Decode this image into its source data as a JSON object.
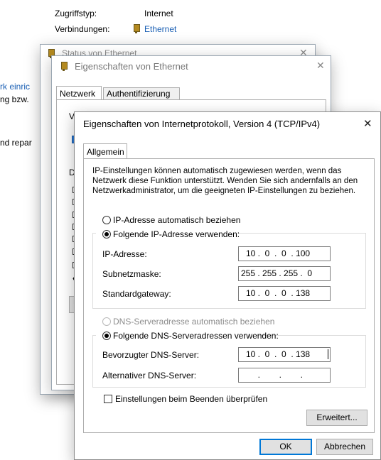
{
  "background": {
    "access_type_label": "Zugriffstyp:",
    "access_type_value": "Internet",
    "connections_label": "Verbindungen:",
    "connections_value": "Ethernet",
    "left_fragments": [
      "rk einric",
      "ng bzw.",
      "nd repar"
    ]
  },
  "status_window": {
    "title": "Status von Ethernet",
    "close_glyph": "✕"
  },
  "properties_window": {
    "title": "Eigenschaften von Ethernet",
    "close_glyph": "✕",
    "tabs": [
      "Netzwerk",
      "Authentifizierung"
    ],
    "fragment_top": "Verbindung herstellen über:",
    "fragment_list": "Die",
    "fragment_e": "B"
  },
  "ipv4_dialog": {
    "title": "Eigenschaften von Internetprotokoll, Version 4 (TCP/IPv4)",
    "close_glyph": "✕",
    "tab": "Allgemein",
    "description": [
      "IP-Einstellungen können automatisch zugewiesen werden, wenn das",
      "Netzwerk diese Funktion unterstützt. Wenden Sie sich andernfalls an den",
      "Netzwerkadministrator, um die geeigneten IP-Einstellungen zu beziehen."
    ],
    "ip_auto_label": "IP-Adresse automatisch beziehen",
    "ip_manual_label": "Folgende IP-Adresse verwenden:",
    "ip_address_label": "IP-Adresse:",
    "ip_address_value": "10 .  0  .  0  . 100",
    "subnet_label": "Subnetzmaske:",
    "subnet_value": "255 . 255 . 255 .  0",
    "gateway_label": "Standardgateway:",
    "gateway_value": "10 .  0  .  0  . 138",
    "dns_auto_label": "DNS-Serveradresse automatisch beziehen",
    "dns_manual_label": "Folgende DNS-Serveradressen verwenden:",
    "dns_preferred_label": "Bevorzugter DNS-Server:",
    "dns_preferred_value": "10 .  0  .  0  . 138",
    "dns_alternate_label": "Alternativer DNS-Server:",
    "dns_alternate_value": "     .        .        .",
    "validate_label": "Einstellungen beim Beenden überprüfen",
    "advanced_button": "Erweitert...",
    "ok_button": "OK",
    "cancel_button": "Abbrechen"
  },
  "colors": {
    "accent": "#0078d7",
    "link": "#1a5fb4"
  }
}
